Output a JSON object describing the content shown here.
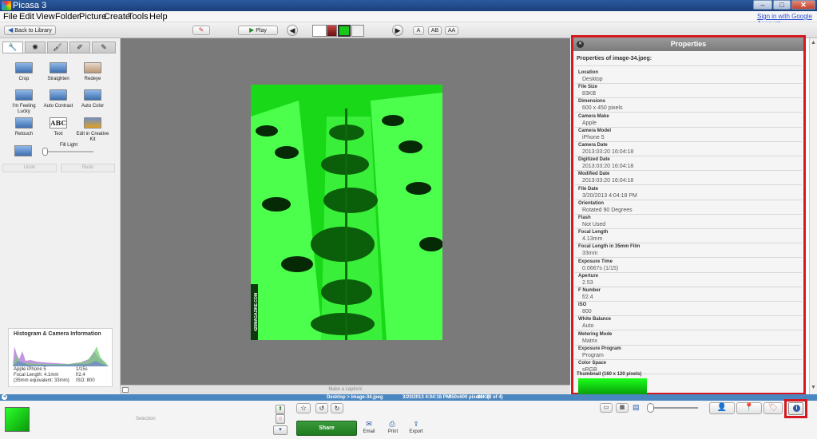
{
  "window": {
    "title": "Picasa 3",
    "min": "–",
    "max": "□",
    "close": "✕"
  },
  "menu": [
    "File",
    "Edit",
    "View",
    "Folder",
    "Picture",
    "Create",
    "Tools",
    "Help"
  ],
  "signin": "Sign in with Google Account",
  "toolbar": {
    "back_label": "Back to Library",
    "play_label": "Play",
    "text_size_buttons": [
      "A",
      "AB",
      "AA"
    ]
  },
  "left_panel": {
    "tabs": [
      "wrench-icon",
      "sun-icon",
      "brush-icon",
      "pen-icon",
      "palette-icon"
    ],
    "tools": [
      "Crop",
      "Straighten",
      "Redeye",
      "I'm Feeling Lucky",
      "Auto Contrast",
      "Auto Color",
      "Retouch",
      "Text",
      "Edit in Creative Kit"
    ],
    "fill_light": "Fill Light",
    "undo": "Undo",
    "redo": "Redo",
    "histogram_title": "Histogram & Camera Information",
    "camera_lines_left": [
      "Apple iPhone 5",
      "Focal Length: 4.1mm",
      "(35mm equivalent: 33mm)"
    ],
    "camera_lines_right": [
      "1/15s",
      "f/2.4",
      "ISO: 800"
    ]
  },
  "center": {
    "caption_placeholder": "Make a caption!",
    "photo_watermark": "420MAGAZINE.COM"
  },
  "properties": {
    "title": "Properties",
    "subtitle": "Properties of image-34.jpeg:",
    "rows": [
      {
        "key": "Location",
        "value": "Desktop"
      },
      {
        "key": "File Size",
        "value": "83KB"
      },
      {
        "key": "Dimensions",
        "value": "600 x 450 pixels"
      },
      {
        "key": "Camera Make",
        "value": "Apple"
      },
      {
        "key": "Camera Model",
        "value": "iPhone 5"
      },
      {
        "key": "Camera Date",
        "value": "2013:03:20 16:04:18"
      },
      {
        "key": "Digitized Date",
        "value": "2013:03:20 16:04:18"
      },
      {
        "key": "Modified Date",
        "value": "2013:03:20 16:04:18"
      },
      {
        "key": "File Date",
        "value": "3/20/2013 4:04:18 PM"
      },
      {
        "key": "Orientation",
        "value": "Rotated 90 Degrees"
      },
      {
        "key": "Flash",
        "value": "Not Used"
      },
      {
        "key": "Focal Length",
        "value": "4.13mm"
      },
      {
        "key": "Focal Length in 35mm Film",
        "value": "33mm"
      },
      {
        "key": "Exposure Time",
        "value": "0.0667s (1/15)"
      },
      {
        "key": "Aperture",
        "value": "2.53"
      },
      {
        "key": "F Number",
        "value": "f/2.4"
      },
      {
        "key": "ISO",
        "value": "800"
      },
      {
        "key": "White Balance",
        "value": "Auto"
      },
      {
        "key": "Metering Mode",
        "value": "Matrix"
      },
      {
        "key": "Exposure Program",
        "value": "Program"
      },
      {
        "key": "Color Space",
        "value": "sRGB"
      }
    ],
    "thumbnail_label": "Thumbnail (160 x 120 pixels)"
  },
  "status": {
    "path": "Desktop > image-34.jpeg",
    "date": "3/20/2013 4:04:18 PM",
    "dims": "450x600 pixels",
    "size": "83KB",
    "index": "(3 of 4)"
  },
  "tray": {
    "selection_label": "Selection",
    "share_label": "Share",
    "email_label": "Email",
    "print_label": "Print",
    "export_label": "Export"
  },
  "colors": {
    "highlight": "#d61920",
    "photo_green": "#22ff22",
    "status_blue": "#4a86c0"
  }
}
